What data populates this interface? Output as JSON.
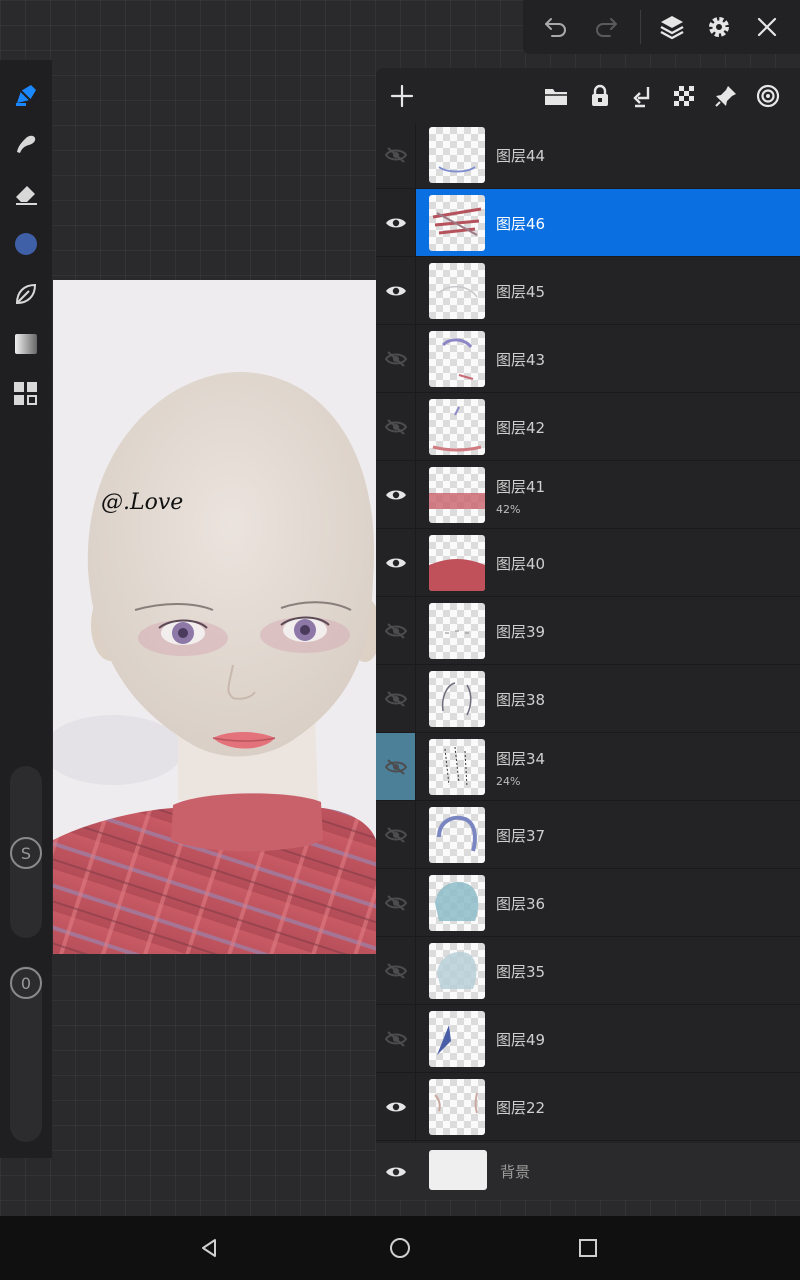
{
  "top_toolbar": {
    "icons": [
      "undo-icon",
      "redo-icon",
      "layers-icon",
      "settings-icon",
      "close-icon"
    ]
  },
  "left_toolbar": {
    "tools": [
      "brush-icon",
      "smudge-icon",
      "eraser-icon",
      "color-swatch",
      "leaf-brush-icon",
      "gradient-fill-icon",
      "grid-menu-icon"
    ],
    "current_color": "#3f5fa6",
    "size_slider_label": "S",
    "opacity_slider_label": "0"
  },
  "canvas": {
    "watermark": "@.Love"
  },
  "layers_panel": {
    "header_icons": [
      "add-layer-icon",
      "folder-icon",
      "lock-icon",
      "merge-down-icon",
      "checker-icon",
      "pin-icon",
      "target-icon"
    ],
    "layers": [
      {
        "name": "图层44",
        "visible": false,
        "selected": false,
        "clip": false,
        "opacity": ""
      },
      {
        "name": "图层46",
        "visible": true,
        "selected": true,
        "clip": false,
        "opacity": ""
      },
      {
        "name": "图层45",
        "visible": true,
        "selected": false,
        "clip": false,
        "opacity": ""
      },
      {
        "name": "图层43",
        "visible": false,
        "selected": false,
        "clip": false,
        "opacity": ""
      },
      {
        "name": "图层42",
        "visible": false,
        "selected": false,
        "clip": false,
        "opacity": ""
      },
      {
        "name": "图层41",
        "visible": true,
        "selected": false,
        "clip": false,
        "opacity": "42%"
      },
      {
        "name": "图层40",
        "visible": true,
        "selected": false,
        "clip": false,
        "opacity": ""
      },
      {
        "name": "图层39",
        "visible": false,
        "selected": false,
        "clip": false,
        "opacity": ""
      },
      {
        "name": "图层38",
        "visible": false,
        "selected": false,
        "clip": false,
        "opacity": ""
      },
      {
        "name": "图层34",
        "visible": false,
        "selected": false,
        "clip": true,
        "opacity": "24%"
      },
      {
        "name": "图层37",
        "visible": false,
        "selected": false,
        "clip": false,
        "opacity": ""
      },
      {
        "name": "图层36",
        "visible": false,
        "selected": false,
        "clip": false,
        "opacity": ""
      },
      {
        "name": "图层35",
        "visible": false,
        "selected": false,
        "clip": false,
        "opacity": ""
      },
      {
        "name": "图层49",
        "visible": false,
        "selected": false,
        "clip": false,
        "opacity": ""
      },
      {
        "name": "图层22",
        "visible": true,
        "selected": false,
        "clip": false,
        "opacity": ""
      }
    ],
    "background_layer": {
      "name": "背景",
      "visible": true
    }
  },
  "nav_bar": {
    "icons": [
      "back-icon",
      "home-icon",
      "recents-icon"
    ]
  },
  "colors": {
    "accent": "#0a6fe0",
    "clip_marker": "#4c7f98",
    "panel_bg": "#232325"
  }
}
